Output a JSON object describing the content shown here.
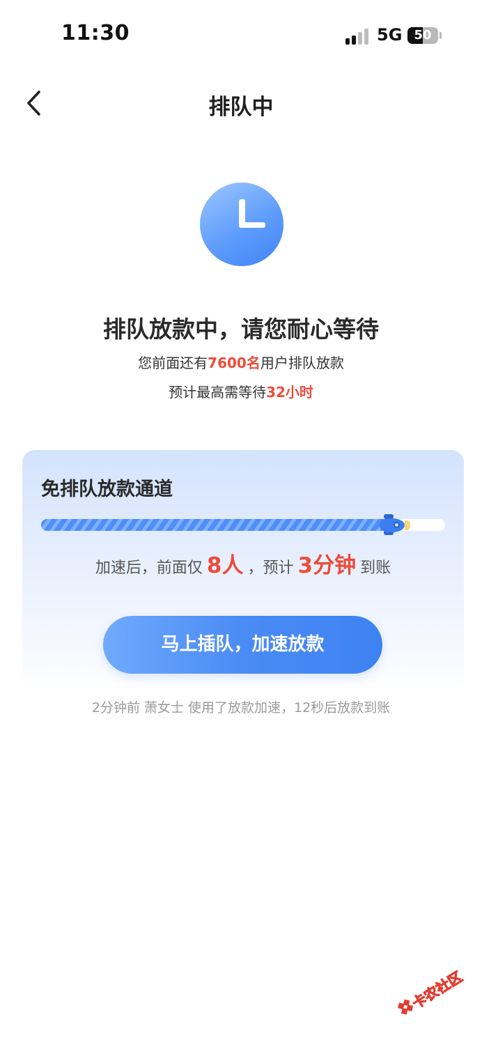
{
  "status_bar": {
    "time": "11:30",
    "network": "5G",
    "battery_level": "50",
    "battery_fraction": 0.5
  },
  "nav": {
    "back_icon": "chevron-left-icon",
    "title": "排队中"
  },
  "status_icon": "clock-icon",
  "headline": "排队放款中，请您耐心等待",
  "queue_info": {
    "prefix": "您前面还有",
    "count": "7600名",
    "suffix": "用户排队放款"
  },
  "wait_info": {
    "prefix": "预计最高需等待",
    "hours": "32小时"
  },
  "fast_channel": {
    "title": "免排队放款通道",
    "progress_fraction": 0.88,
    "progress_icon": "rocket-icon",
    "boost_prefix": "加速后，前面仅",
    "people": "8人",
    "middle": "，预计",
    "minutes": "3分钟",
    "boost_suffix": "到账",
    "button_label": "马上插队，加速放款"
  },
  "ticker": "2分钟前 萧女士 使用了放款加速，12秒后放款到账",
  "watermark": "卡农社区",
  "colors": {
    "accent_blue": "#4a8bf5",
    "highlight_red": "#ef4b3a",
    "card_bg_top": "#d3e3fe"
  }
}
